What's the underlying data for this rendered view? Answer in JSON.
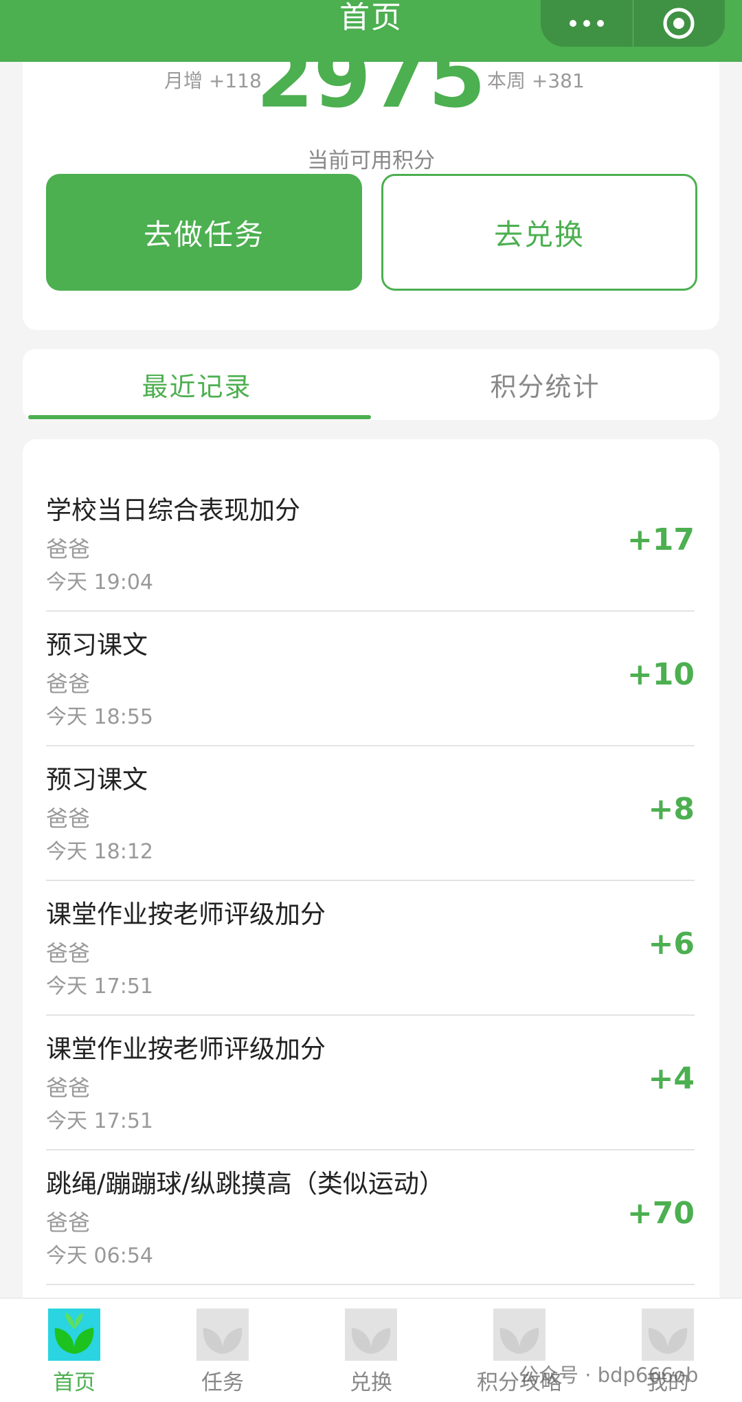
{
  "header": {
    "title": "首页"
  },
  "points": {
    "month_stat": "月增 +118",
    "week_stat": "本周 +381",
    "current": "2975",
    "label": "当前可用积分"
  },
  "actions": {
    "task_label": "去做任务",
    "exchange_label": "去兑换"
  },
  "tabs": [
    {
      "label": "最近记录",
      "active": true
    },
    {
      "label": "积分统计",
      "active": false
    }
  ],
  "records": [
    {
      "title": "学校当日综合表现加分",
      "who": "爸爸",
      "time": "今天 19:04",
      "points": "+17"
    },
    {
      "title": "预习课文",
      "who": "爸爸",
      "time": "今天 18:55",
      "points": "+10"
    },
    {
      "title": "预习课文",
      "who": "爸爸",
      "time": "今天 18:12",
      "points": "+8"
    },
    {
      "title": "课堂作业按老师评级加分",
      "who": "爸爸",
      "time": "今天 17:51",
      "points": "+6"
    },
    {
      "title": "课堂作业按老师评级加分",
      "who": "爸爸",
      "time": "今天 17:51",
      "points": "+4"
    },
    {
      "title": "跳绳/蹦蹦球/纵跳摸高（类似运动）",
      "who": "爸爸",
      "time": "今天 06:54",
      "points": "+70"
    }
  ],
  "nav": [
    {
      "label": "首页",
      "icon": "sprout-icon",
      "active": true
    },
    {
      "label": "任务",
      "icon": "sprout-icon",
      "active": false
    },
    {
      "label": "兑换",
      "icon": "sprout-icon",
      "active": false
    },
    {
      "label": "积分攻略",
      "icon": "sprout-icon",
      "active": false
    },
    {
      "label": "我的",
      "icon": "sprout-icon",
      "active": false
    }
  ],
  "watermark": "公众号 · bdp666ob",
  "colors": {
    "brand": "#4caf50",
    "active_icon_bg": "#2ad4e0"
  }
}
